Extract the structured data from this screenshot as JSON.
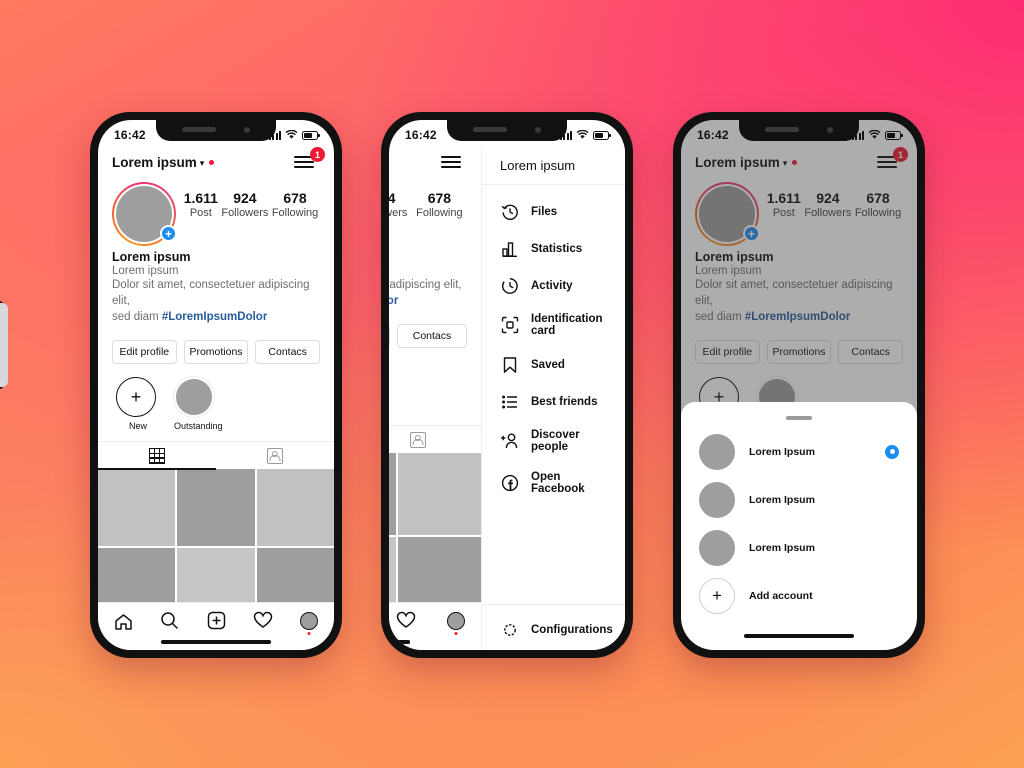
{
  "background": {
    "top_right": "#fd2e72",
    "bottom_left": "#fba154",
    "mid": "#fd5d6d"
  },
  "status_bar": {
    "time": "16:42",
    "signal_icon": "signal-bars-icon",
    "wifi_icon": "wifi-icon",
    "battery_icon": "battery-icon"
  },
  "profile": {
    "username": "Lorem ipsum",
    "chevron": "⌄",
    "menu_badge": "1",
    "stats": [
      {
        "value": "1.611",
        "label": "Post"
      },
      {
        "value": "924",
        "label": "Followers"
      },
      {
        "value": "678",
        "label": "Following"
      }
    ],
    "bio": {
      "display_name": "Lorem ipsum",
      "subtitle": "Lorem ipsum",
      "text_line1": "Dolor sit amet, consectetuer adipiscing elit,",
      "text_line2": "sed diam ",
      "hashtag": "#LoremIpsumDolor"
    },
    "buttons": [
      "Edit profile",
      "Promotions",
      "Contacs"
    ],
    "highlights": [
      {
        "label": "New",
        "type": "add"
      },
      {
        "label": "Outstanding",
        "type": "image"
      }
    ],
    "tabs": [
      {
        "icon": "grid-icon",
        "active": true
      },
      {
        "icon": "tagged-photos-icon",
        "active": false
      }
    ],
    "grid_tones": [
      "#c1c1c1",
      "#9e9e9e",
      "#c1c1c1",
      "#9e9e9e",
      "#c6c6c6",
      "#9e9e9e",
      "#c1c1c1",
      "#9e9e9e",
      "#c1c1c1"
    ],
    "accent_blue": "#1c8ef0",
    "accent_red": "#ed1b34",
    "hashtag_color": "#2a5c9b"
  },
  "bottom_nav": [
    {
      "icon": "home-icon"
    },
    {
      "icon": "search-icon"
    },
    {
      "icon": "add-post-icon"
    },
    {
      "icon": "heart-icon"
    },
    {
      "icon": "profile-avatar-icon"
    }
  ],
  "side_menu": {
    "title": "Lorem ipsum",
    "items": [
      {
        "label": "Files",
        "icon": "history-clock-icon"
      },
      {
        "label": "Statistics",
        "icon": "bar-chart-icon"
      },
      {
        "label": "Activity",
        "icon": "activity-clock-icon"
      },
      {
        "label": "Identification card",
        "icon": "qr-code-icon"
      },
      {
        "label": "Saved",
        "icon": "bookmark-icon"
      },
      {
        "label": "Best friends",
        "icon": "list-icon"
      },
      {
        "label": "Discover people",
        "icon": "add-person-icon"
      },
      {
        "label": "Open Facebook",
        "icon": "facebook-icon"
      }
    ],
    "footer": {
      "label": "Configurations",
      "icon": "gear-icon"
    }
  },
  "account_sheet": {
    "accounts": [
      {
        "name": "Lorem Ipsum",
        "selected": true
      },
      {
        "name": "Lorem Ipsum",
        "selected": false
      },
      {
        "name": "Lorem Ipsum",
        "selected": false
      }
    ],
    "add_account_label": "Add account",
    "add_icon": "plus-icon"
  }
}
